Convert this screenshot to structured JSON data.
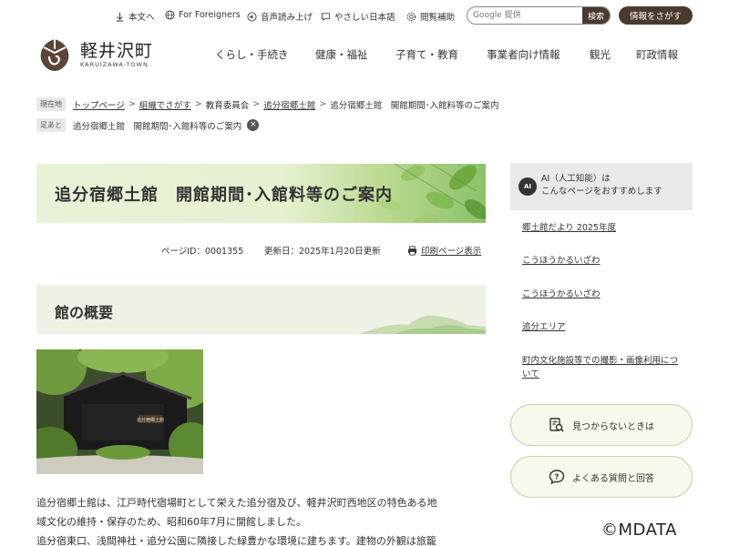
{
  "utility": {
    "main_text": "本文へ",
    "foreigners": "For Foreigners",
    "read_aloud": "音声読み上げ",
    "easy_japanese": "やさしい日本語",
    "viewing_aid": "閲覧補助",
    "search_placeholder": "Google 提供",
    "search_button": "検索",
    "info_button": "情報をさがす"
  },
  "header": {
    "logo_jp": "軽井沢町",
    "logo_en": "KARUIZAWA-TOWN",
    "nav": [
      "くらし・手続き",
      "健康・福祉",
      "子育て・教育",
      "事業者向け情報",
      "観光",
      "町政情報"
    ]
  },
  "breadcrumb": {
    "tag": "現在地",
    "items": [
      "トップページ",
      "組織でさがす",
      "教育委員会",
      "追分宿郷土館"
    ],
    "current": "追分宿郷土館　開館期間･入館料等のご案内",
    "seps": [
      ">",
      ">",
      ">",
      ">"
    ]
  },
  "footprints": {
    "tag": "足あと",
    "item": "追分宿郷土館　開館期間･入館料等のご案内",
    "close": "×"
  },
  "main": {
    "title": "追分宿郷土館　開館期間･入館料等のご案内",
    "page_id": "ページID：0001355",
    "updated": "更新日：2025年1月20日更新",
    "print": "印刷ページ表示",
    "section_title": "館の概要",
    "photo_sign": "追分宿郷土館",
    "body_lines": [
      "追分宿郷土館は、江戸時代宿場町として栄えた追分宿及び、軽井沢町西地区の特色ある地",
      "域文化の維持・保存のため、昭和60年7月に開館しました。",
      "追分宿東口、浅間神社・追分公園に隣接した緑豊かな環境に建ちます。建物の外観は旅籠"
    ]
  },
  "sidebar": {
    "ai_badge": "AI",
    "ai_line1": "AI（人工知能）は",
    "ai_line2": "こんなページをおすすめします",
    "links": [
      "郷土館だより 2025年度",
      "こうほうかるいざわ",
      "こうほうかるいざわ",
      "追分エリア",
      "町内文化施設等での撮影・画像利用について"
    ],
    "btn_not_found": "見つからないときは",
    "btn_faq": "よくある質問と回答"
  },
  "watermark": "©MDATA",
  "colors": {
    "brand_brown": "#4a3a2e",
    "title_green_light": "#e8f2d6",
    "section_bg": "#eef3e6",
    "button_border": "#c9d4a8"
  }
}
